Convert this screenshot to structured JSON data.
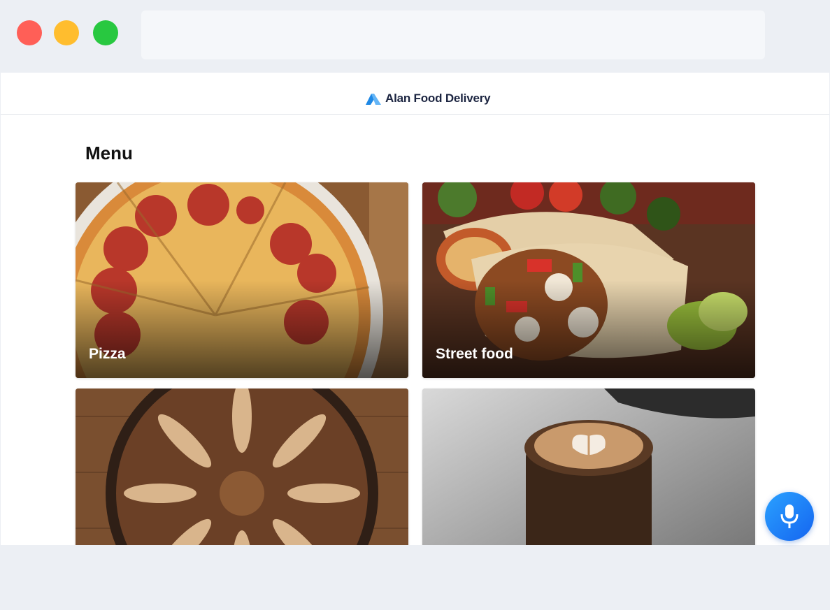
{
  "window": {
    "address": ""
  },
  "header": {
    "brand": "Alan Food Delivery"
  },
  "main": {
    "title": "Menu",
    "categories": [
      {
        "label": "Pizza"
      },
      {
        "label": "Street food"
      },
      {
        "label": ""
      },
      {
        "label": ""
      }
    ]
  },
  "icons": {
    "logo": "alan-logo-icon",
    "voice": "microphone-icon"
  },
  "colors": {
    "brand_text": "#1b2440",
    "mic_button": "#1e7ff5"
  }
}
